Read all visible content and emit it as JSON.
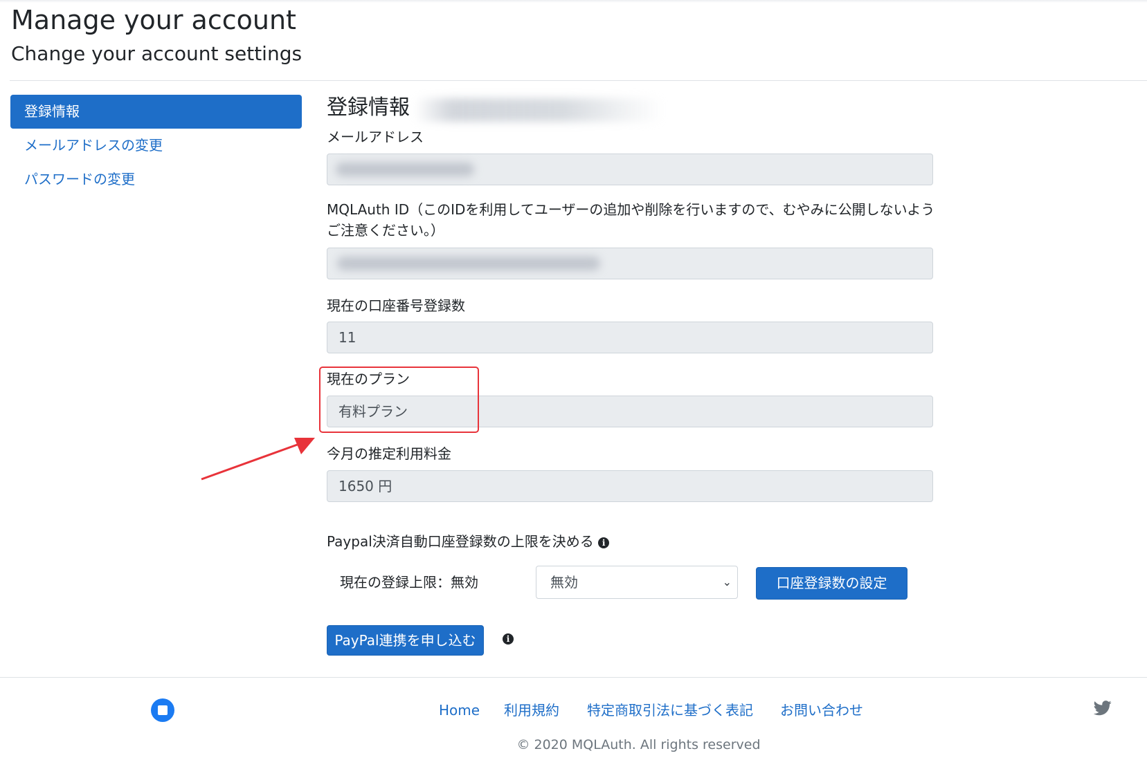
{
  "header": {
    "title": "Manage your account",
    "subtitle": "Change your account settings"
  },
  "sidebar": {
    "items": [
      {
        "label": "登録情報",
        "active": true
      },
      {
        "label": "メールアドレスの変更",
        "active": false
      },
      {
        "label": "パスワードの変更",
        "active": false
      }
    ]
  },
  "main": {
    "section_title": "登録情報",
    "email_label": "メールアドレス",
    "email_value": "",
    "id_label": "MQLAuth ID（このIDを利用してユーザーの追加や削除を行いますので、むやみに公開しないようご注意ください。）",
    "id_value": "",
    "account_count_label": "現在の口座番号登録数",
    "account_count_value": "11",
    "plan_label": "現在のプラン",
    "plan_value": "有料プラン",
    "fee_label": "今月の推定利用料金",
    "fee_value": "1650 円",
    "paypal_limit_label": "Paypal決済自動口座登録数の上限を決める",
    "current_limit_label": "現在の登録上限：無効",
    "limit_select_value": "無効",
    "set_limit_button": "口座登録数の設定",
    "paypal_apply_button": "PayPal連携を申し込む"
  },
  "footer": {
    "links": [
      "Home",
      "利用規約",
      "特定商取引法に基づく表記",
      "お問い合わせ"
    ],
    "copyright": "© 2020 MQLAuth. All rights reserved"
  },
  "colors": {
    "primary": "#1e6ec8",
    "field_bg": "#e9ecef",
    "annotation_red": "#e8333a"
  },
  "icons": {
    "info": "info-icon",
    "twitter": "twitter-icon",
    "logo": "logo-icon",
    "chevron": "chevron-down-icon"
  }
}
